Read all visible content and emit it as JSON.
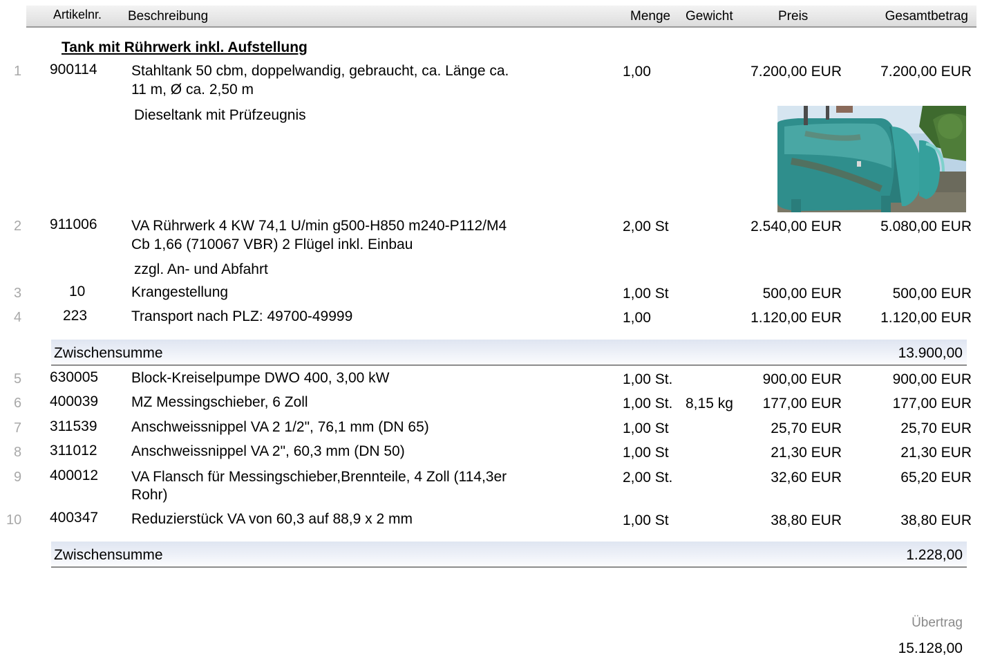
{
  "header": {
    "artikelnr": "Artikelnr.",
    "beschreibung": "Beschreibung",
    "menge": "Menge",
    "gewicht": "Gewicht",
    "preis": "Preis",
    "gesamtbetrag": "Gesamtbetrag"
  },
  "section_title": "Tank mit Rührwerk inkl. Aufstellung",
  "items": [
    {
      "pos": "1",
      "artikelnr": "900114",
      "desc1": "Stahltank 50 cbm, doppelwandig, gebraucht, ca. Länge ca.",
      "desc2": "11 m, Ø ca. 2,50 m",
      "note": "Dieseltank mit Prüfzeugnis",
      "menge": "1,00",
      "gewicht": "",
      "preis": "7.200,00 EUR",
      "gesamt": "7.200,00 EUR"
    },
    {
      "pos": "2",
      "artikelnr": "911006",
      "desc1": "VA Rührwerk 4 KW 74,1 U/min g500-H850 m240-P112/M4",
      "desc2": "Cb 1,66 (710067 VBR) 2 Flügel inkl. Einbau",
      "note": "zzgl. An- und Abfahrt",
      "menge": "2,00 St",
      "gewicht": "",
      "preis": "2.540,00 EUR",
      "gesamt": "5.080,00 EUR"
    },
    {
      "pos": "3",
      "artikelnr": "10",
      "desc1": "Krangestellung",
      "menge": "1,00 St",
      "gewicht": "",
      "preis": "500,00 EUR",
      "gesamt": "500,00 EUR"
    },
    {
      "pos": "4",
      "artikelnr": "223",
      "desc1": "Transport nach PLZ: 49700-49999",
      "menge": "1,00",
      "gewicht": "",
      "preis": "1.120,00 EUR",
      "gesamt": "1.120,00 EUR"
    },
    {
      "pos": "5",
      "artikelnr": "630005",
      "desc1": "Block-Kreiselpumpe DWO 400, 3,00 kW",
      "menge": "1,00 St.",
      "gewicht": "",
      "preis": "900,00 EUR",
      "gesamt": "900,00 EUR"
    },
    {
      "pos": "6",
      "artikelnr": "400039",
      "desc1": "MZ Messingschieber, 6 Zoll",
      "menge": "1,00 St.",
      "gewicht": "8,15 kg",
      "preis": "177,00 EUR",
      "gesamt": "177,00 EUR"
    },
    {
      "pos": "7",
      "artikelnr": "311539",
      "desc1": "Anschweissnippel VA 2 1/2\", 76,1 mm (DN 65)",
      "menge": "1,00 St",
      "gewicht": "",
      "preis": "25,70 EUR",
      "gesamt": "25,70 EUR"
    },
    {
      "pos": "8",
      "artikelnr": "311012",
      "desc1": "Anschweissnippel VA 2\", 60,3 mm (DN 50)",
      "menge": "1,00 St",
      "gewicht": "",
      "preis": "21,30 EUR",
      "gesamt": "21,30 EUR"
    },
    {
      "pos": "9",
      "artikelnr": "400012",
      "desc1": "VA Flansch für Messingschieber,Brennteile, 4 Zoll (114,3er",
      "desc2": "Rohr)",
      "menge": "2,00 St.",
      "gewicht": "",
      "preis": "32,60 EUR",
      "gesamt": "65,20 EUR"
    },
    {
      "pos": "10",
      "artikelnr": "400347",
      "desc1": "Reduzierstück VA von 60,3 auf 88,9 x 2 mm",
      "menge": "1,00 St",
      "gewicht": "",
      "preis": "38,80 EUR",
      "gesamt": "38,80 EUR"
    }
  ],
  "subtotals": [
    {
      "label": "Zwischensumme",
      "value": "13.900,00"
    },
    {
      "label": "Zwischensumme",
      "value": "1.228,00"
    }
  ],
  "footer": {
    "uebertrag_label": "Übertrag",
    "uebertrag_value": "15.128,00"
  },
  "colors": {
    "tank": "#2f8e8c",
    "tank_highlight": "#5fbcb8",
    "sky": "#bcd4e6",
    "foliage": "#3e6a2e"
  }
}
